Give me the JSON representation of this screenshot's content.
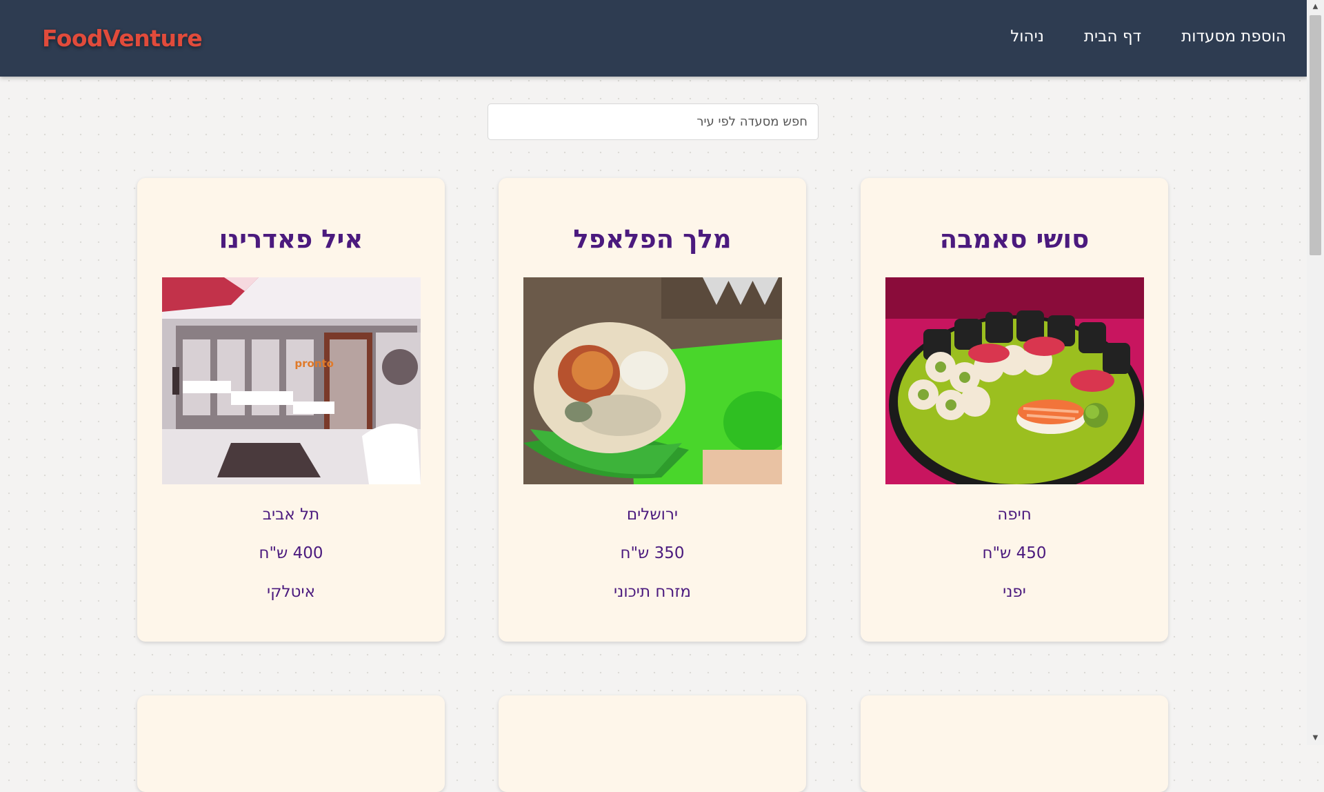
{
  "brand": "FoodVenture",
  "nav": {
    "admin": "ניהול",
    "home": "דף הבית",
    "add_restaurants": "הוספת מסעדות"
  },
  "search": {
    "placeholder": "חפש מסעדה לפי עיר"
  },
  "restaurants": [
    {
      "name": "סושי סאמבה",
      "city": "חיפה",
      "price": "450 ש\"ח",
      "cuisine": "יפני"
    },
    {
      "name": "מלך הפלאפל",
      "city": "ירושלים",
      "price": "350 ש\"ח",
      "cuisine": "מזרח תיכוני"
    },
    {
      "name": "איל פאדרינו",
      "city": "תל אביב",
      "price": "400 ש\"ח",
      "cuisine": "איטלקי"
    }
  ],
  "restaurant_image_sign": "pronto",
  "colors": {
    "navbar": "#2e3c51",
    "brand": "#e14b3b",
    "card_background": "#fef6ea",
    "card_text": "#4b1a7e",
    "page_background": "#f4f3f2"
  }
}
